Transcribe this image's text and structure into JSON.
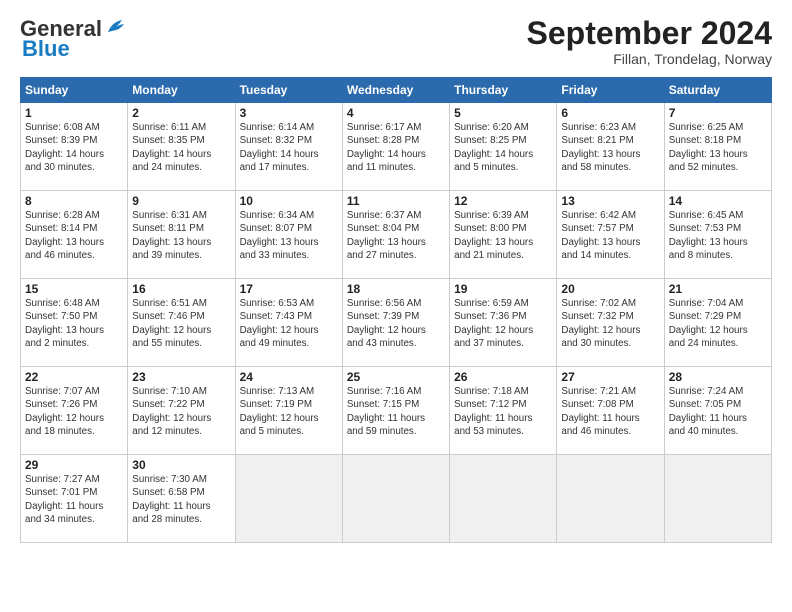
{
  "logo": {
    "line1": "General",
    "line2": "Blue"
  },
  "title": "September 2024",
  "subtitle": "Fillan, Trondelag, Norway",
  "headers": [
    "Sunday",
    "Monday",
    "Tuesday",
    "Wednesday",
    "Thursday",
    "Friday",
    "Saturday"
  ],
  "weeks": [
    [
      {
        "day": "1",
        "detail": "Sunrise: 6:08 AM\nSunset: 8:39 PM\nDaylight: 14 hours\nand 30 minutes."
      },
      {
        "day": "2",
        "detail": "Sunrise: 6:11 AM\nSunset: 8:35 PM\nDaylight: 14 hours\nand 24 minutes."
      },
      {
        "day": "3",
        "detail": "Sunrise: 6:14 AM\nSunset: 8:32 PM\nDaylight: 14 hours\nand 17 minutes."
      },
      {
        "day": "4",
        "detail": "Sunrise: 6:17 AM\nSunset: 8:28 PM\nDaylight: 14 hours\nand 11 minutes."
      },
      {
        "day": "5",
        "detail": "Sunrise: 6:20 AM\nSunset: 8:25 PM\nDaylight: 14 hours\nand 5 minutes."
      },
      {
        "day": "6",
        "detail": "Sunrise: 6:23 AM\nSunset: 8:21 PM\nDaylight: 13 hours\nand 58 minutes."
      },
      {
        "day": "7",
        "detail": "Sunrise: 6:25 AM\nSunset: 8:18 PM\nDaylight: 13 hours\nand 52 minutes."
      }
    ],
    [
      {
        "day": "8",
        "detail": "Sunrise: 6:28 AM\nSunset: 8:14 PM\nDaylight: 13 hours\nand 46 minutes."
      },
      {
        "day": "9",
        "detail": "Sunrise: 6:31 AM\nSunset: 8:11 PM\nDaylight: 13 hours\nand 39 minutes."
      },
      {
        "day": "10",
        "detail": "Sunrise: 6:34 AM\nSunset: 8:07 PM\nDaylight: 13 hours\nand 33 minutes."
      },
      {
        "day": "11",
        "detail": "Sunrise: 6:37 AM\nSunset: 8:04 PM\nDaylight: 13 hours\nand 27 minutes."
      },
      {
        "day": "12",
        "detail": "Sunrise: 6:39 AM\nSunset: 8:00 PM\nDaylight: 13 hours\nand 21 minutes."
      },
      {
        "day": "13",
        "detail": "Sunrise: 6:42 AM\nSunset: 7:57 PM\nDaylight: 13 hours\nand 14 minutes."
      },
      {
        "day": "14",
        "detail": "Sunrise: 6:45 AM\nSunset: 7:53 PM\nDaylight: 13 hours\nand 8 minutes."
      }
    ],
    [
      {
        "day": "15",
        "detail": "Sunrise: 6:48 AM\nSunset: 7:50 PM\nDaylight: 13 hours\nand 2 minutes."
      },
      {
        "day": "16",
        "detail": "Sunrise: 6:51 AM\nSunset: 7:46 PM\nDaylight: 12 hours\nand 55 minutes."
      },
      {
        "day": "17",
        "detail": "Sunrise: 6:53 AM\nSunset: 7:43 PM\nDaylight: 12 hours\nand 49 minutes."
      },
      {
        "day": "18",
        "detail": "Sunrise: 6:56 AM\nSunset: 7:39 PM\nDaylight: 12 hours\nand 43 minutes."
      },
      {
        "day": "19",
        "detail": "Sunrise: 6:59 AM\nSunset: 7:36 PM\nDaylight: 12 hours\nand 37 minutes."
      },
      {
        "day": "20",
        "detail": "Sunrise: 7:02 AM\nSunset: 7:32 PM\nDaylight: 12 hours\nand 30 minutes."
      },
      {
        "day": "21",
        "detail": "Sunrise: 7:04 AM\nSunset: 7:29 PM\nDaylight: 12 hours\nand 24 minutes."
      }
    ],
    [
      {
        "day": "22",
        "detail": "Sunrise: 7:07 AM\nSunset: 7:26 PM\nDaylight: 12 hours\nand 18 minutes."
      },
      {
        "day": "23",
        "detail": "Sunrise: 7:10 AM\nSunset: 7:22 PM\nDaylight: 12 hours\nand 12 minutes."
      },
      {
        "day": "24",
        "detail": "Sunrise: 7:13 AM\nSunset: 7:19 PM\nDaylight: 12 hours\nand 5 minutes."
      },
      {
        "day": "25",
        "detail": "Sunrise: 7:16 AM\nSunset: 7:15 PM\nDaylight: 11 hours\nand 59 minutes."
      },
      {
        "day": "26",
        "detail": "Sunrise: 7:18 AM\nSunset: 7:12 PM\nDaylight: 11 hours\nand 53 minutes."
      },
      {
        "day": "27",
        "detail": "Sunrise: 7:21 AM\nSunset: 7:08 PM\nDaylight: 11 hours\nand 46 minutes."
      },
      {
        "day": "28",
        "detail": "Sunrise: 7:24 AM\nSunset: 7:05 PM\nDaylight: 11 hours\nand 40 minutes."
      }
    ],
    [
      {
        "day": "29",
        "detail": "Sunrise: 7:27 AM\nSunset: 7:01 PM\nDaylight: 11 hours\nand 34 minutes."
      },
      {
        "day": "30",
        "detail": "Sunrise: 7:30 AM\nSunset: 6:58 PM\nDaylight: 11 hours\nand 28 minutes."
      },
      {
        "day": "",
        "detail": ""
      },
      {
        "day": "",
        "detail": ""
      },
      {
        "day": "",
        "detail": ""
      },
      {
        "day": "",
        "detail": ""
      },
      {
        "day": "",
        "detail": ""
      }
    ]
  ]
}
